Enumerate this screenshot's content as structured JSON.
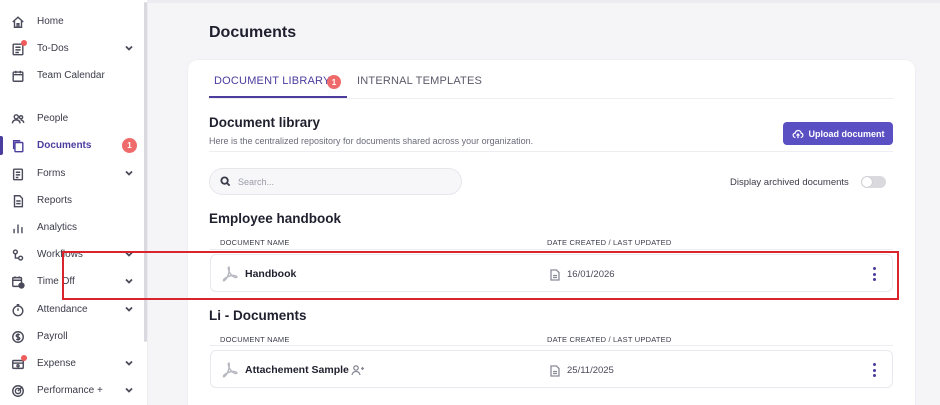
{
  "sidebar": {
    "items": [
      {
        "label": "Home",
        "icon": "home-icon",
        "chevron": false
      },
      {
        "label": "To-Dos",
        "icon": "todos-icon",
        "chevron": true,
        "dot": true
      },
      {
        "label": "Team Calendar",
        "icon": "calendar-icon",
        "chevron": false
      },
      {
        "label": "People",
        "icon": "people-icon",
        "chevron": false
      },
      {
        "label": "Documents",
        "icon": "documents-icon",
        "chevron": false,
        "active": true,
        "badge": "1"
      },
      {
        "label": "Forms",
        "icon": "forms-icon",
        "chevron": true
      },
      {
        "label": "Reports",
        "icon": "reports-icon",
        "chevron": false
      },
      {
        "label": "Analytics",
        "icon": "analytics-icon",
        "chevron": false
      },
      {
        "label": "Workflows",
        "icon": "workflows-icon",
        "chevron": true
      },
      {
        "label": "Time Off",
        "icon": "time-off-icon",
        "chevron": true
      },
      {
        "label": "Attendance",
        "icon": "attendance-icon",
        "chevron": true
      },
      {
        "label": "Payroll",
        "icon": "payroll-icon",
        "chevron": false
      },
      {
        "label": "Expense",
        "icon": "expense-icon",
        "chevron": true,
        "dot": true
      },
      {
        "label": "Performance +",
        "icon": "performance-icon",
        "chevron": true
      }
    ]
  },
  "page": {
    "title": "Documents"
  },
  "tabs": [
    {
      "label": "DOCUMENT LIBRARY",
      "active": true,
      "badge": "1"
    },
    {
      "label": "INTERNAL TEMPLATES",
      "active": false
    }
  ],
  "library": {
    "title": "Document library",
    "subtitle": "Here is the centralized repository for documents shared across your organization.",
    "upload_label": "Upload document",
    "search_placeholder": "Search...",
    "archived_label": "Display archived documents",
    "archived_on": false
  },
  "sections": [
    {
      "title": "Employee handbook",
      "col_name": "DOCUMENT NAME",
      "col_date": "DATE CREATED / LAST UPDATED",
      "docs": [
        {
          "name": "Handbook",
          "date": "16/01/2026",
          "shared": false
        }
      ]
    },
    {
      "title": "Li - Documents",
      "col_name": "DOCUMENT NAME",
      "col_date": "DATE CREATED / LAST UPDATED",
      "docs": [
        {
          "name": "Attachement Sample",
          "date": "25/11/2025",
          "shared": true
        }
      ]
    }
  ],
  "colors": {
    "accent": "#4a3d9e",
    "button": "#5b4fc4",
    "badge": "#ef6b6b",
    "highlight": "#d9232d"
  }
}
